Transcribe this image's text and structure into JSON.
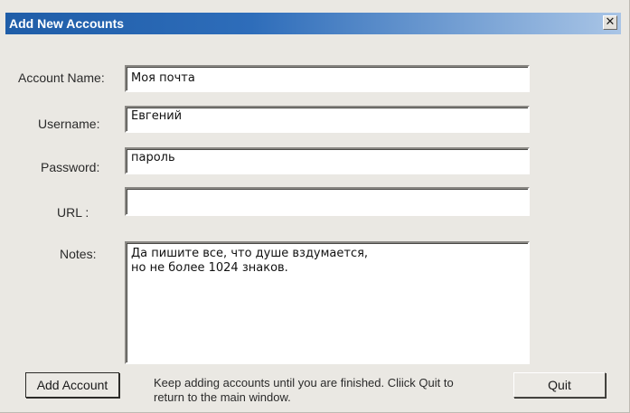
{
  "window": {
    "title": "Add New Accounts",
    "close_glyph": "✕"
  },
  "form": {
    "account_name": {
      "label": "Account Name:",
      "value": "Моя почта"
    },
    "username": {
      "label": "Username:",
      "value": "Евгений"
    },
    "password": {
      "label": "Password:",
      "value": "пароль"
    },
    "url": {
      "label": "URL :",
      "value": ""
    },
    "notes": {
      "label": "Notes:",
      "value": "Да пишите все, что душе вздумается,\nно не более 1024 знаков."
    }
  },
  "footer": {
    "add_label": "Add Account",
    "hint": "Keep adding accounts until you are finished.  Cliick Quit to return to the main window.",
    "quit_label": "Quit"
  }
}
